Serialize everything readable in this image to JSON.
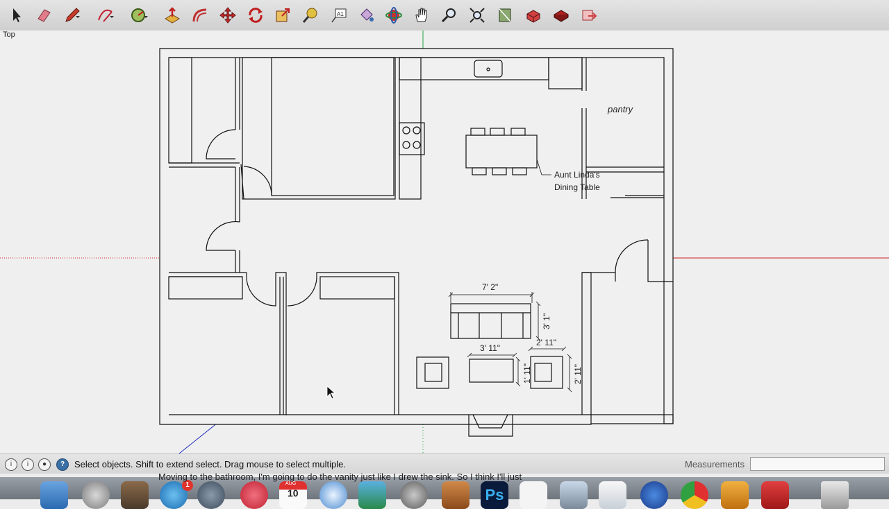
{
  "toolbar": {
    "tools": [
      {
        "name": "select",
        "icon": "select-arrow-icon",
        "color": "#222222"
      },
      {
        "name": "eraser",
        "icon": "eraser-icon",
        "color": "#e05a6a"
      },
      {
        "name": "line",
        "icon": "pencil-icon",
        "color": "#b02020"
      },
      {
        "name": "arc",
        "icon": "arc-icon",
        "color": "#c02030"
      },
      {
        "name": "shape",
        "icon": "circle-shape-icon",
        "color": "#4a7a2a"
      },
      {
        "name": "push-pull",
        "icon": "push-pull-icon",
        "color": "#c03030"
      },
      {
        "name": "offset",
        "icon": "offset-icon",
        "color": "#c03030"
      },
      {
        "name": "move",
        "icon": "move-icon",
        "color": "#c02020"
      },
      {
        "name": "rotate",
        "icon": "rotate-icon",
        "color": "#c02020"
      },
      {
        "name": "scale",
        "icon": "scale-icon",
        "color": "#c03030"
      },
      {
        "name": "tape-measure",
        "icon": "tape-measure-icon",
        "color": "#a88a20"
      },
      {
        "name": "text",
        "icon": "text-tool-icon",
        "color": "#333333"
      },
      {
        "name": "paint-bucket",
        "icon": "paint-bucket-icon",
        "color": "#6a4a8a"
      },
      {
        "name": "orbit",
        "icon": "orbit-icon",
        "color": "#2a8a3a"
      },
      {
        "name": "pan",
        "icon": "pan-hand-icon",
        "color": "#333333"
      },
      {
        "name": "zoom",
        "icon": "zoom-icon",
        "color": "#333333"
      },
      {
        "name": "zoom-extents",
        "icon": "zoom-extents-icon",
        "color": "#333333"
      },
      {
        "name": "3d-warehouse",
        "icon": "warehouse-icon",
        "color": "#3a6a3a"
      },
      {
        "name": "components",
        "icon": "components-icon",
        "color": "#c03030"
      },
      {
        "name": "extension-warehouse",
        "icon": "extension-icon",
        "color": "#b02020"
      },
      {
        "name": "share-model",
        "icon": "share-model-icon",
        "color": "#d04040"
      }
    ]
  },
  "viewport": {
    "scene_label": "Top",
    "labels": {
      "pantry": "pantry",
      "dining_table_line1": "Aunt Linda's",
      "dining_table_line2": "Dining Table"
    },
    "dimensions": {
      "sofa_width": "7' 2\"",
      "sofa_depth": "3' 1\"",
      "coffee_table_width": "3' 11\"",
      "coffee_table_depth": "1' 11\"",
      "chair_width": "2' 11\"",
      "chair_depth": "2' 11\""
    },
    "colors": {
      "red_axis": "#d02020",
      "green_axis": "#20a040",
      "blue_axis": "#2030c0"
    }
  },
  "statusbar": {
    "status_text": "Select objects. Shift to extend select. Drag mouse to select multiple.",
    "measurements_label": "Measurements",
    "measurements_value": "",
    "help_glyph": "?"
  },
  "caption": {
    "text": "Moving to the bathroom, I'm going to do the vanity just like I drew the sink. So I think I'll just"
  },
  "dock": {
    "calendar_month": "AUG",
    "calendar_day": "10",
    "app_store_badge": "1"
  }
}
